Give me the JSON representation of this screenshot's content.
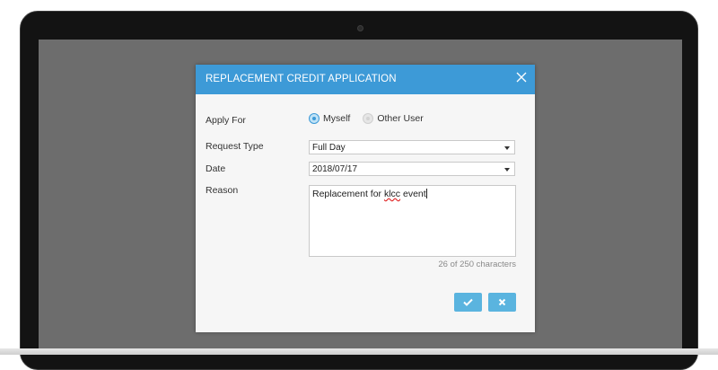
{
  "dialog": {
    "title": "REPLACEMENT CREDIT APPLICATION",
    "close_icon": "close-icon",
    "apply_for": {
      "label": "Apply For",
      "options": [
        {
          "label": "Myself",
          "selected": true
        },
        {
          "label": "Other User",
          "selected": false
        }
      ]
    },
    "request_type": {
      "label": "Request Type",
      "value": "Full Day"
    },
    "date": {
      "label": "Date",
      "value": "2018/07/17"
    },
    "reason": {
      "label": "Reason",
      "text_before": "Replacement for ",
      "misspelled": "klcc",
      "text_after": " event",
      "char_count": "26 of 250 characters"
    },
    "buttons": {
      "confirm_icon": "check-icon",
      "cancel_icon": "x-icon"
    }
  },
  "colors": {
    "header": "#3d9ad7",
    "button": "#5ab4df",
    "screen_bg": "#6d6d6d",
    "dialog_bg": "#f6f6f6"
  }
}
